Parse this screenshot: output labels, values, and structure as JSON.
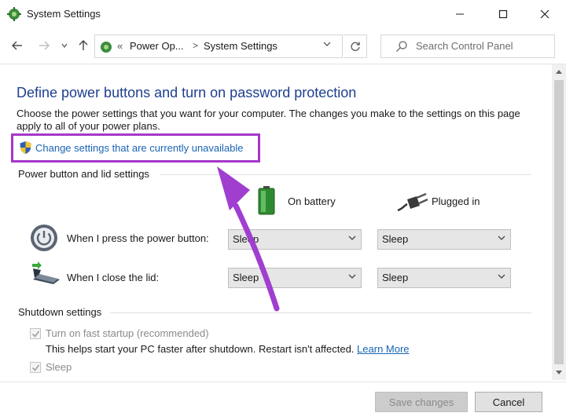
{
  "window": {
    "title": "System Settings",
    "controls": {
      "minimize": "minimize-icon",
      "maximize": "maximize-icon",
      "close": "close-icon"
    }
  },
  "nav": {
    "breadcrumb_prefix": "«",
    "breadcrumbs": [
      "Power Op...",
      "System Settings"
    ],
    "breadcrumb_separator": ">",
    "search_placeholder": "Search Control Panel"
  },
  "main": {
    "title": "Define power buttons and turn on password protection",
    "description": "Choose the power settings that you want for your computer. The changes you make to the settings on this page apply to all of your power plans.",
    "change_settings_link": "Change settings that are currently unavailable",
    "power_section": {
      "label": "Power button and lid settings",
      "columns": [
        "On battery",
        "Plugged in"
      ],
      "rows": [
        {
          "label": "When I press the power button:",
          "on_battery": "Sleep",
          "plugged_in": "Sleep"
        },
        {
          "label": "When I close the lid:",
          "on_battery": "Sleep",
          "plugged_in": "Sleep"
        }
      ]
    },
    "shutdown_section": {
      "label": "Shutdown settings",
      "fast_startup_label": "Turn on fast startup (recommended)",
      "fast_startup_help": "This helps start your PC faster after shutdown. Restart isn't affected.",
      "learn_more": "Learn More",
      "sleep_label": "Sleep"
    }
  },
  "footer": {
    "save_label": "Save changes",
    "cancel_label": "Cancel"
  },
  "colors": {
    "title_blue": "#1e3f8f",
    "link_blue": "#1a64b5",
    "highlight_purple": "#a537c9",
    "arrow_purple": "#a03ed0"
  }
}
